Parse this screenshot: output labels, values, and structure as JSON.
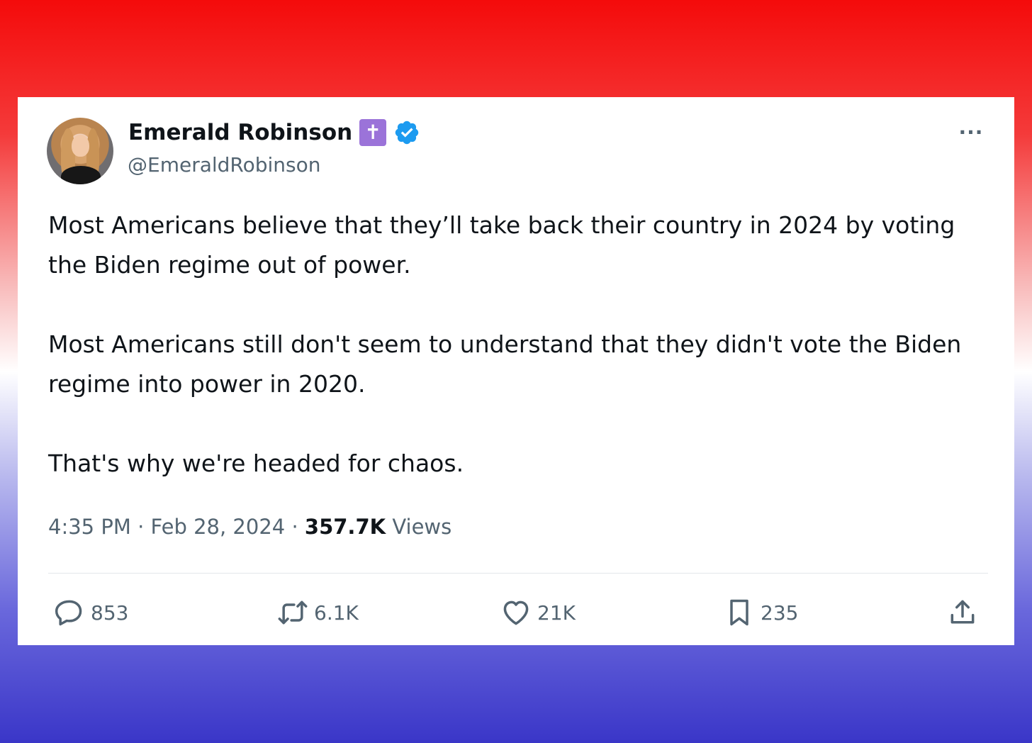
{
  "tweet": {
    "author_name": "Emerald Robinson",
    "handle": "@EmeraldRobinson",
    "badge_glyph": "✝",
    "more_label": "···",
    "paragraphs": [
      "Most Americans believe that they’ll take back their country in 2024 by voting the Biden regime out of power.",
      "Most Americans still don't seem to understand that they didn't vote the Biden regime into power in 2020.",
      "That's why we're headed for chaos."
    ],
    "time": "4:35 PM",
    "date": "Feb 28, 2024",
    "separator": "·",
    "views_count": "357.7K",
    "views_label": "Views"
  },
  "actions": {
    "replies": "853",
    "reposts": "6.1K",
    "likes": "21K",
    "bookmarks": "235"
  },
  "icons": {
    "reply": "reply-icon",
    "repost": "repost-icon",
    "like": "heart-icon",
    "bookmark": "bookmark-icon",
    "share": "share-icon",
    "verified": "verified-badge-icon",
    "more": "more-options-icon"
  },
  "colors": {
    "verified_blue": "#1d9bf0",
    "badge_purple": "#9b73d9",
    "text_primary": "#0f1419",
    "text_secondary": "#536471"
  }
}
